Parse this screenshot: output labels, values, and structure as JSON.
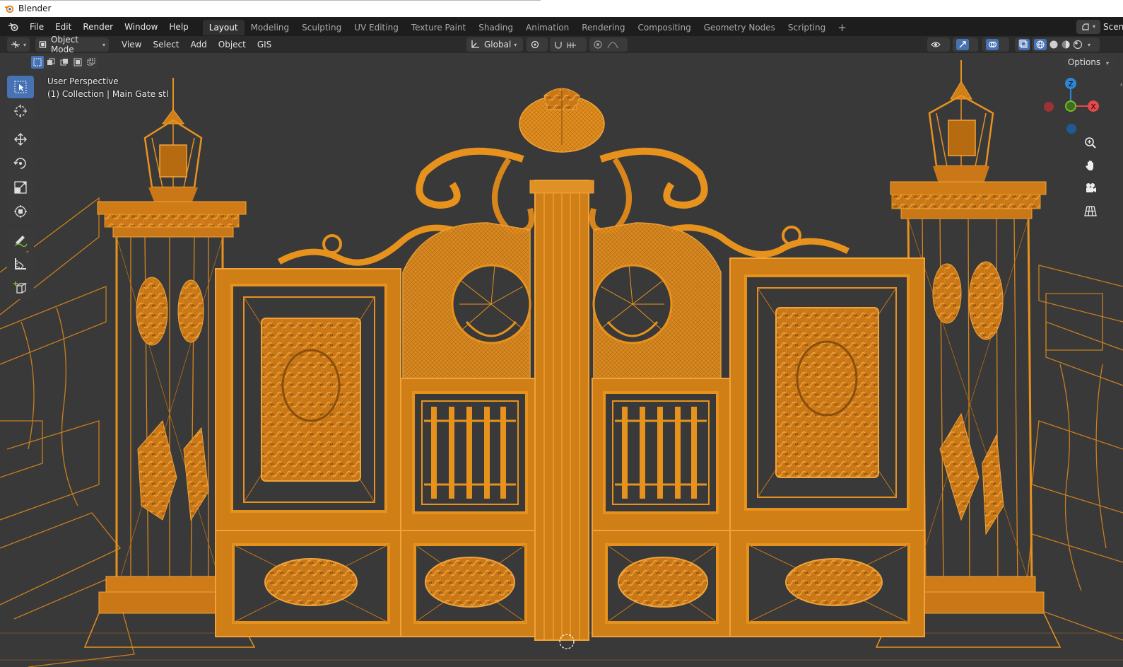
{
  "app": {
    "title": "Blender"
  },
  "menu": [
    "File",
    "Edit",
    "Render",
    "Window",
    "Help"
  ],
  "workspaces": [
    {
      "label": "Layout",
      "active": true
    },
    {
      "label": "Modeling"
    },
    {
      "label": "Sculpting"
    },
    {
      "label": "UV Editing"
    },
    {
      "label": "Texture Paint"
    },
    {
      "label": "Shading"
    },
    {
      "label": "Animation"
    },
    {
      "label": "Rendering"
    },
    {
      "label": "Compositing"
    },
    {
      "label": "Geometry Nodes"
    },
    {
      "label": "Scripting"
    }
  ],
  "scene": {
    "label": "Scene"
  },
  "header": {
    "mode": "Object Mode",
    "menus": [
      "View",
      "Select",
      "Add",
      "Object",
      "GIS"
    ],
    "transform_orientation": "Global"
  },
  "viewport": {
    "options_label": "Options",
    "overlay_line1": "User Perspective",
    "overlay_line2": "(1) Collection | Main Gate stl",
    "wire_color": "#e8921e",
    "background_color": "#393939"
  },
  "gizmo": {
    "axes": {
      "z": "Z",
      "x": "X"
    },
    "colors": {
      "x": "#e4484c",
      "y": "#7ab82b",
      "z": "#2f86d6"
    }
  },
  "icons": {
    "toolbar": [
      "select-box-icon",
      "cursor-icon",
      "move-icon",
      "rotate-icon",
      "scale-icon",
      "transform-icon",
      "annotate-icon",
      "measure-icon",
      "add-cube-icon"
    ],
    "nav": [
      "zoom-icon",
      "pan-hand-icon",
      "camera-icon",
      "grid-icon"
    ]
  }
}
